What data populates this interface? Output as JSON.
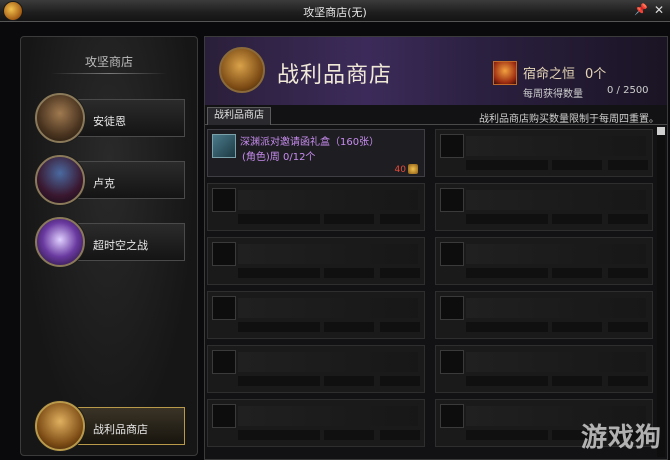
{
  "window": {
    "title": "攻坚商店(无)"
  },
  "left_panel": {
    "heading": "攻坚商店",
    "npcs": [
      {
        "label": "安徒恩",
        "icon": "antoine-portrait"
      },
      {
        "label": "卢克",
        "icon": "luke-portrait"
      },
      {
        "label": "超时空之战",
        "icon": "time-rift-portrait"
      }
    ],
    "shop_button": {
      "label": "战利品商店",
      "icon": "loot-bag-icon"
    }
  },
  "banner": {
    "title": "战利品商店",
    "currency_name": "宿命之恒",
    "currency_count": "0个",
    "weekly_label": "每周获得数量",
    "weekly_value": "0 / 2500"
  },
  "tabs": [
    {
      "label": "战利品商店"
    }
  ],
  "notice": "战利品商店购买数量限制于每周四重置。",
  "items": [
    {
      "name": "深渊派对邀请函礼盒（160张）",
      "limit": "(角色)周 0/12个",
      "price": "40",
      "empty": false
    },
    {
      "empty": true
    },
    {
      "empty": true
    },
    {
      "empty": true
    },
    {
      "empty": true
    },
    {
      "empty": true
    },
    {
      "empty": true
    },
    {
      "empty": true
    },
    {
      "empty": true
    },
    {
      "empty": true
    },
    {
      "empty": true
    },
    {
      "empty": true
    }
  ],
  "watermark": "游戏狗",
  "colors": {
    "item_name": "#c88cf0",
    "price": "#e84a3a",
    "banner": "#3c2b5a"
  }
}
